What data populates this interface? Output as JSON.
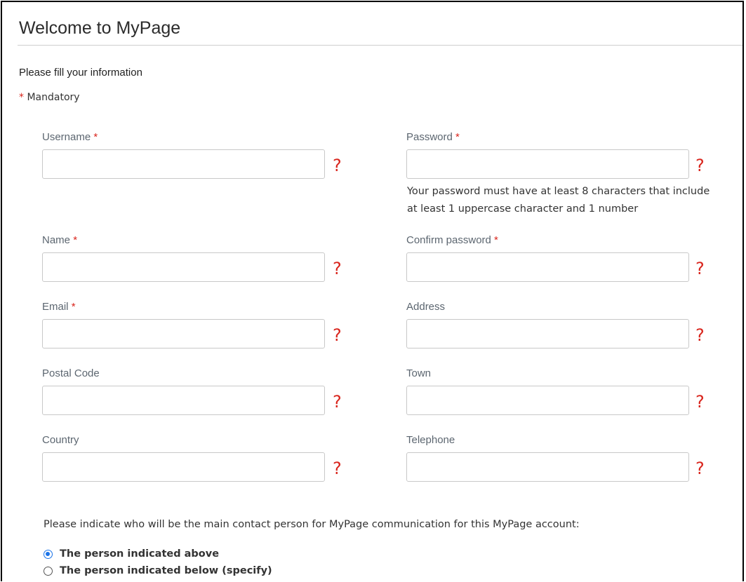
{
  "header": {
    "title": "Welcome to MyPage"
  },
  "intro": "Please fill your information",
  "mandatory": {
    "star": "*",
    "label": "Mandatory"
  },
  "required_star": "*",
  "help_icon": {
    "glyph": "?",
    "name": "help-question-icon",
    "color": "#d9251d"
  },
  "fields": {
    "username": {
      "label": "Username",
      "required": true,
      "value": ""
    },
    "password": {
      "label": "Password",
      "required": true,
      "value": "",
      "hint": "Your password must have at least 8 characters that include at least 1 uppercase character and 1 number"
    },
    "name": {
      "label": "Name",
      "required": true,
      "value": ""
    },
    "confirm_password": {
      "label": "Confirm password",
      "required": true,
      "value": ""
    },
    "email": {
      "label": "Email",
      "required": true,
      "value": ""
    },
    "address": {
      "label": "Address",
      "required": false,
      "value": ""
    },
    "postal_code": {
      "label": "Postal Code",
      "required": false,
      "value": ""
    },
    "town": {
      "label": "Town",
      "required": false,
      "value": ""
    },
    "country": {
      "label": "Country",
      "required": false,
      "value": ""
    },
    "telephone": {
      "label": "Telephone",
      "required": false,
      "value": ""
    }
  },
  "contact": {
    "question": "Please indicate who will be the main contact person for MyPage communication for this MyPage account:",
    "options": [
      {
        "label": "The person indicated above",
        "selected": true
      },
      {
        "label": "The person indicated below (specify)",
        "selected": false
      }
    ]
  },
  "colors": {
    "accent": "#1a73e8",
    "required": "#d9251d",
    "label": "#5c6670"
  }
}
